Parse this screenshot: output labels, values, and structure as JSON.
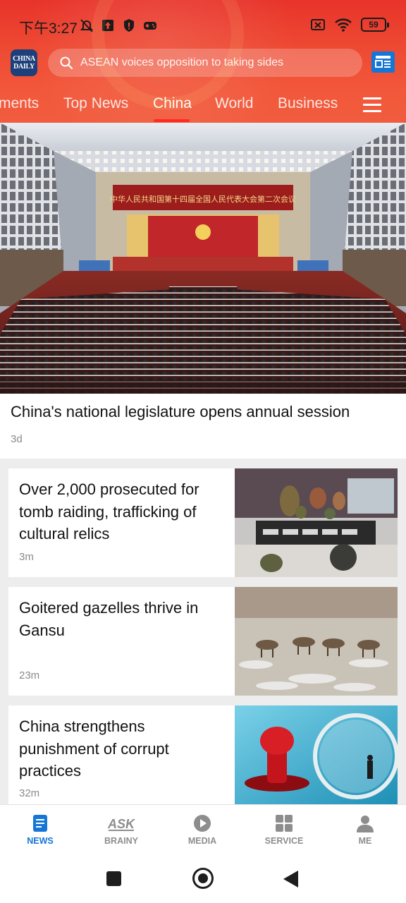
{
  "status_bar": {
    "time": "下午3:27",
    "battery": "59",
    "icons": [
      "mute-bell-icon",
      "upload-icon",
      "shield-icon",
      "gamepad-icon",
      "sim-off-icon",
      "wifi-icon",
      "battery-icon"
    ]
  },
  "header": {
    "logo_text": "CHINA DAILY",
    "search_placeholder": "ASEAN voices opposition to taking sides",
    "tabs": [
      {
        "label": "ments"
      },
      {
        "label": "Top News"
      },
      {
        "label": "China",
        "active": true
      },
      {
        "label": "World"
      },
      {
        "label": "Business"
      }
    ],
    "accent_color": "#e8332a",
    "active_tab_color": "#ff2a24"
  },
  "hero": {
    "banner_text": "中华人民共和国第十四届全国人民代表大会第二次会议",
    "title": "China's national legislature opens annual session",
    "time": "3d"
  },
  "stories": [
    {
      "title": "Over 2,000 prosecuted for tomb raiding, trafficking of cultural relics",
      "time": "3m"
    },
    {
      "title": "Goitered gazelles thrive in Gansu",
      "time": "23m"
    },
    {
      "title": "China strengthens punishment of corrupt practices",
      "time": "32m"
    }
  ],
  "bottom_nav": [
    {
      "label": "NEWS",
      "icon": "news-icon",
      "active": true
    },
    {
      "label": "BRAINY",
      "icon": "ask-icon"
    },
    {
      "label": "MEDIA",
      "icon": "play-icon"
    },
    {
      "label": "SERVICE",
      "icon": "grid-icon"
    },
    {
      "label": "ME",
      "icon": "person-icon"
    }
  ],
  "colors": {
    "nav_active": "#1576d6",
    "nav_inactive": "#8d8d8d"
  }
}
